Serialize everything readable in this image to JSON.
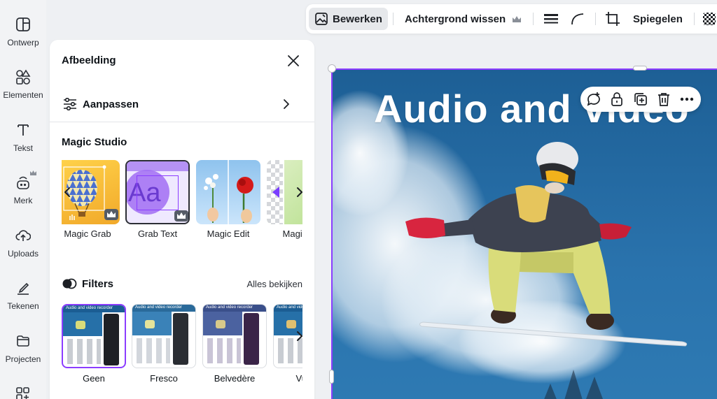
{
  "rail": {
    "items": [
      {
        "label": "Ontwerp",
        "icon": "layout-icon"
      },
      {
        "label": "Elementen",
        "icon": "shapes-icon"
      },
      {
        "label": "Tekst",
        "icon": "text-icon"
      },
      {
        "label": "Merk",
        "icon": "brand-icon"
      },
      {
        "label": "Uploads",
        "icon": "cloud-upload-icon"
      },
      {
        "label": "Tekenen",
        "icon": "draw-icon"
      },
      {
        "label": "Projecten",
        "icon": "folder-icon"
      }
    ]
  },
  "panel": {
    "title": "Afbeelding",
    "adjust_label": "Aanpassen",
    "magic_title": "Magic Studio",
    "magic_items": [
      {
        "label": "Magic Grab"
      },
      {
        "label": "Grab Text"
      },
      {
        "label": "Magic Edit"
      },
      {
        "label": "Magic E"
      }
    ],
    "grab_text_glyph": "Aa",
    "filters_title": "Filters",
    "filters_link": "Alles bekijken",
    "filters": [
      {
        "label": "Geen",
        "selected": true
      },
      {
        "label": "Fresco",
        "selected": false
      },
      {
        "label": "Belvedère",
        "selected": false
      },
      {
        "label": "Vuur",
        "selected": false
      }
    ],
    "thumb_caption": "Audio and video recorder"
  },
  "toolbar": {
    "edit_label": "Bewerken",
    "bg_remove_label": "Achtergrond wissen",
    "flip_label": "Spiegelen"
  },
  "canvas": {
    "headline": "Audio and video"
  },
  "colors": {
    "accent": "#8b3dff",
    "sky": "#1b5d93",
    "pants": "#d9dc7a",
    "jacket": "#3d4250",
    "glove": "#d8253f",
    "crown": "#8a8f98"
  }
}
